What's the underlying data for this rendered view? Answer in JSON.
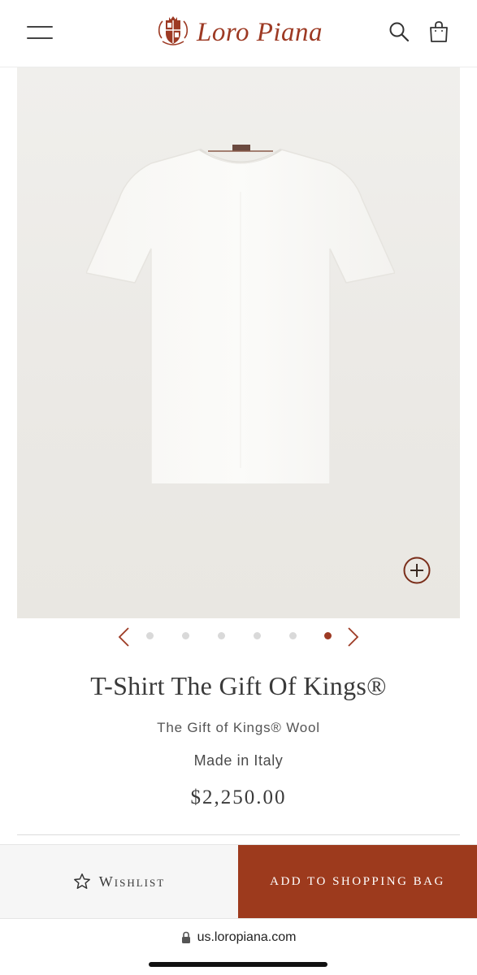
{
  "header": {
    "brand_name": "Loro Piana",
    "icons": [
      "menu-icon",
      "crest-logo",
      "search-icon",
      "shopping-bag-icon"
    ]
  },
  "product": {
    "title": "T-Shirt The Gift Of Kings®",
    "material": "The Gift of Kings® Wool",
    "origin": "Made in Italy",
    "price": "$2,250.00"
  },
  "carousel": {
    "total_images": 6,
    "active_index": 5
  },
  "actions": {
    "wishlist_label": "Wishlist",
    "add_to_bag_label": "ADD TO SHOPPING BAG"
  },
  "browser": {
    "url": "us.loropiana.com"
  },
  "colors": {
    "brand": "#9d3a24",
    "cta_background": "#9d3a1d",
    "dot_inactive": "#d9d9d9"
  }
}
